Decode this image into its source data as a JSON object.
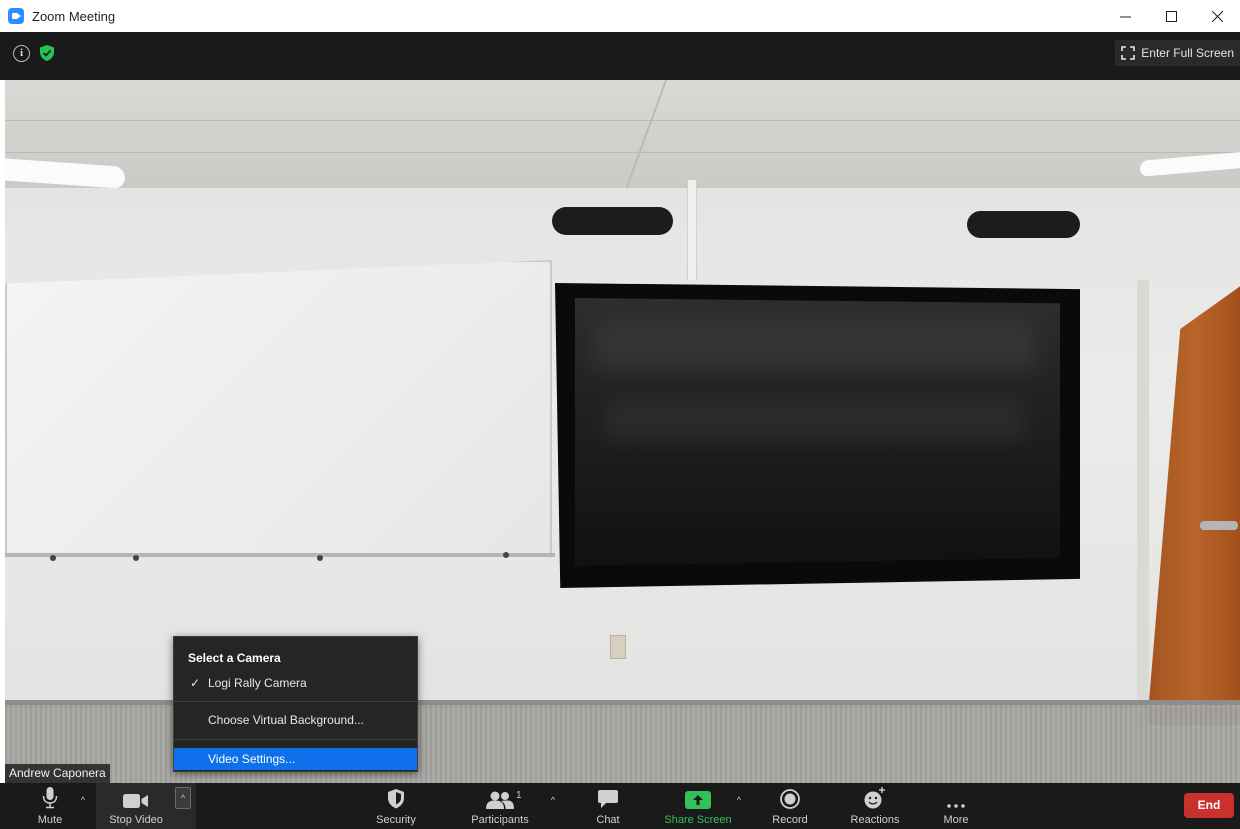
{
  "window": {
    "title": "Zoom Meeting",
    "controls": {
      "minimize": "–",
      "maximize": "☐",
      "close": "✕"
    }
  },
  "meeting_top": {
    "info_icon": "info-icon",
    "security_status_icon": "shield-check-icon",
    "fullscreen_label": "Enter Full Screen"
  },
  "video": {
    "participant_name": "Andrew Caponera"
  },
  "camera_menu": {
    "heading": "Select a Camera",
    "cameras": [
      {
        "label": "Logi Rally Camera",
        "checked": true
      }
    ],
    "items": [
      {
        "label": "Choose Virtual Background..."
      },
      {
        "label": "Video Settings...",
        "highlighted": true
      }
    ]
  },
  "toolbar": {
    "mute_label": "Mute",
    "stop_video_label": "Stop Video",
    "security_label": "Security",
    "participants_label": "Participants",
    "participants_count": "1",
    "chat_label": "Chat",
    "share_screen_label": "Share Screen",
    "record_label": "Record",
    "reactions_label": "Reactions",
    "more_label": "More",
    "end_label": "End",
    "caret": "^",
    "colors": {
      "share_green": "#31c35a",
      "end_red": "#c9312d",
      "highlight_blue": "#0e71eb"
    }
  }
}
